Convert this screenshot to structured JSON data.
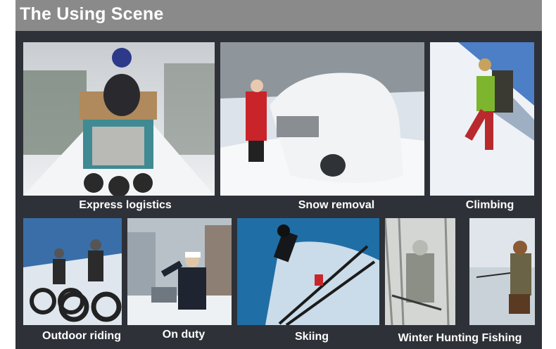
{
  "header": {
    "title": "The Using Scene"
  },
  "scenes": [
    {
      "caption": "Express logistics"
    },
    {
      "caption": "Snow removal"
    },
    {
      "caption": "Climbing"
    },
    {
      "caption": "Outdoor riding"
    },
    {
      "caption": "On duty"
    },
    {
      "caption": "Skiing"
    },
    {
      "caption": "Winter Hunting Fishing"
    }
  ],
  "colors": {
    "header_bg": "#8a8a8a",
    "panel_bg": "#2e3137",
    "caption": "#ffffff"
  }
}
